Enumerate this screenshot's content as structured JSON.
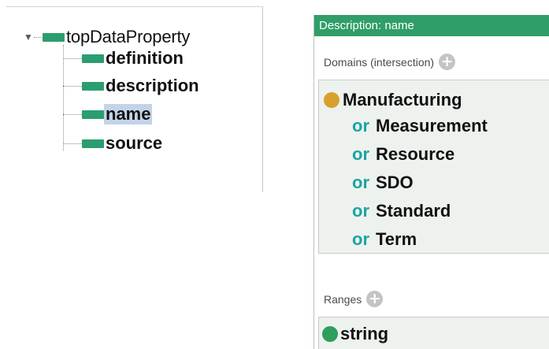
{
  "tree": {
    "root": {
      "label": "topDataProperty",
      "icon": "data-property-icon",
      "expanded": true
    },
    "children": [
      {
        "label": "definition",
        "selected": false
      },
      {
        "label": "description",
        "selected": false
      },
      {
        "label": "name",
        "selected": true
      },
      {
        "label": "source",
        "selected": false
      }
    ]
  },
  "description": {
    "header": "Description: name",
    "domains_title": "Domains (intersection)",
    "domains_first": "Manufacturing",
    "or_keyword": "or",
    "domains_or": [
      "Measurement",
      "Resource",
      "SDO",
      "Standard",
      "Term"
    ],
    "ranges_title": "Ranges",
    "range": "string",
    "add_symbol": "+"
  },
  "colors": {
    "header_bg": "#2f9e68",
    "property_icon": "#2c9d6f",
    "class_dot": "#d6a12d",
    "datatype_dot": "#2e9e5d",
    "or_keyword": "#1aa4a4",
    "selection": "#c3d3e8"
  }
}
